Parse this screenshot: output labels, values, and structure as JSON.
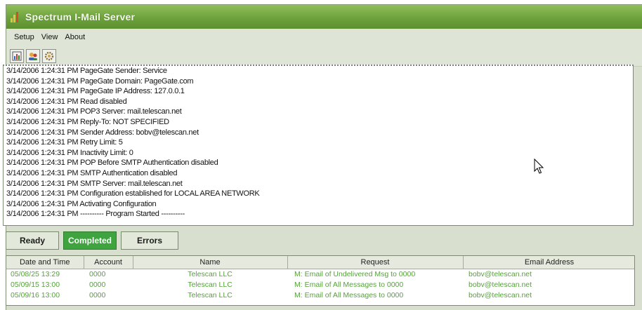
{
  "window": {
    "title": "Spectrum I-Mail Server"
  },
  "menu": [
    "Setup",
    "View",
    "About"
  ],
  "toolbar": [
    "log-icon",
    "users-icon",
    "settings-icon"
  ],
  "log_lines": [
    "3/14/2006 1:24:31 PM PageGate Sender: Service",
    "3/14/2006 1:24:31 PM PageGate Domain: PageGate.com",
    "3/14/2006 1:24:31 PM PageGate IP Address: 127.0.0.1",
    "3/14/2006 1:24:31 PM Read disabled",
    "3/14/2006 1:24:31 PM POP3 Server: mail.telescan.net",
    "3/14/2006 1:24:31 PM Reply-To: NOT SPECIFIED",
    "3/14/2006 1:24:31 PM Sender Address: bobv@telescan.net",
    "3/14/2006 1:24:31 PM Retry Limit: 5",
    "3/14/2006 1:24:31 PM Inactivity Limit: 0",
    "3/14/2006 1:24:31 PM POP Before SMTP Authentication disabled",
    "3/14/2006 1:24:31 PM SMTP Authentication disabled",
    "3/14/2006 1:24:31 PM SMTP Server: mail.telescan.net",
    "3/14/2006 1:24:31 PM Configuration established for LOCAL AREA NETWORK",
    "3/14/2006 1:24:31 PM Activating Configuration",
    "3/14/2006 1:24:31 PM ---------- Program Started ----------"
  ],
  "tabs": [
    {
      "label": "Ready",
      "active": false
    },
    {
      "label": "Completed",
      "active": true
    },
    {
      "label": "Errors",
      "active": false
    }
  ],
  "table": {
    "columns": [
      "Date and Time",
      "Account",
      "Name",
      "Request",
      "Email Address"
    ],
    "rows": [
      [
        "05/08/25 13:29",
        "0000",
        "Telescan LLC",
        "M: Email of Undelivered Msg to 0000",
        "bobv@telescan.net"
      ],
      [
        "05/09/15 13:00",
        "0000",
        "Telescan LLC",
        "M: Email of All Messages to 0000",
        "bobv@telescan.net"
      ],
      [
        "05/09/16 13:00",
        "0000",
        "Telescan LLC",
        "M: Email of All Messages to 0000",
        "bobv@telescan.net"
      ]
    ]
  },
  "colors": {
    "titlebar": "#6ea23c",
    "active_tab": "#3fa33f",
    "row_text": "#56a13c"
  }
}
